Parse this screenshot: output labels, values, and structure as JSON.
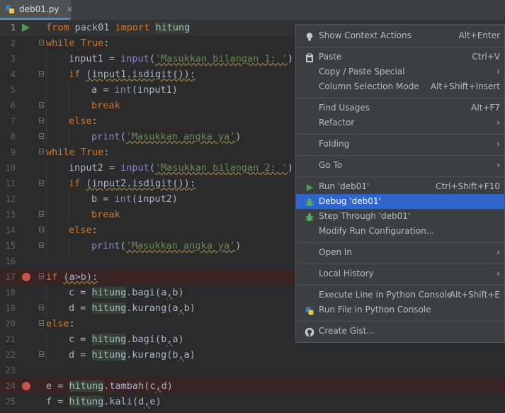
{
  "tab": {
    "filename": "deb01.py",
    "close": "×"
  },
  "editor": {
    "lines": [
      {
        "n": "1"
      },
      {
        "n": "2"
      },
      {
        "n": "3"
      },
      {
        "n": "4"
      },
      {
        "n": "5"
      },
      {
        "n": "6"
      },
      {
        "n": "7"
      },
      {
        "n": "8"
      },
      {
        "n": "9"
      },
      {
        "n": "10"
      },
      {
        "n": "11"
      },
      {
        "n": "12"
      },
      {
        "n": "13"
      },
      {
        "n": "14"
      },
      {
        "n": "15"
      },
      {
        "n": "16"
      },
      {
        "n": "17"
      },
      {
        "n": "18"
      },
      {
        "n": "19"
      },
      {
        "n": "20"
      },
      {
        "n": "21"
      },
      {
        "n": "22"
      },
      {
        "n": "23"
      },
      {
        "n": "24"
      },
      {
        "n": "25"
      }
    ],
    "tok": {
      "from": "from",
      "pack01": " pack01 ",
      "import": "import",
      "hitung": "hitung",
      "while": "while",
      "true": "True",
      "colon": ":",
      "input1": "input1 = ",
      "input": "input",
      "lp": "(",
      "rp": ")",
      "prompt1": "'Masukkan bilangan 1: '",
      "prompt2": "'Masukkan bilangan 2: '",
      "if": "if",
      "sp": " ",
      "cond1": "(input1.isdigit()):",
      "cond2": "(input2.isdigit()):",
      "a_eq": "a = ",
      "b_eq": "b = ",
      "int": "int",
      "arg1": "(input1)",
      "arg2": "(input2)",
      "break": "break",
      "else": "else",
      "print": "print",
      "msg": "'Masukkan angka ya'",
      "input2": "input2 = ",
      "cond_ab": "(a>b):",
      "c_eq": "c = ",
      "d_eq": "d = ",
      "bagi": ".bagi(",
      "kurang": ".kurang(",
      "tambah": ".tambah(",
      "kali": ".kali(",
      "a": "a",
      "b": "b",
      "c": "c",
      "d": "d",
      "comma": ",",
      "e_eq": "e = ",
      "f_eq": "f = "
    }
  },
  "menu": {
    "items": [
      {
        "label": "Show Context Actions",
        "shortcut": "Alt+Enter",
        "icon": "lightbulb-icon"
      },
      {
        "label": "Paste",
        "shortcut": "Ctrl+V",
        "icon": "clipboard-icon"
      },
      {
        "label": "Copy / Paste Special",
        "submenu": "›"
      },
      {
        "label": "Column Selection Mode",
        "shortcut": "Alt+Shift+Insert"
      },
      {
        "label": "Find Usages",
        "shortcut": "Alt+F7"
      },
      {
        "label": "Refactor",
        "submenu": "›"
      },
      {
        "label": "Folding",
        "submenu": "›"
      },
      {
        "label": "Go To",
        "submenu": "›"
      },
      {
        "label": "Run 'deb01'",
        "shortcut": "Ctrl+Shift+F10",
        "icon": "run-icon"
      },
      {
        "label": "Debug 'deb01'",
        "icon": "bug-icon"
      },
      {
        "label": "Step Through 'deb01'",
        "icon": "bug-icon"
      },
      {
        "label": "Modify Run Configuration..."
      },
      {
        "label": "Open In",
        "submenu": "›"
      },
      {
        "label": "Local History",
        "submenu": "›"
      },
      {
        "label": "Execute Line in Python Console",
        "shortcut": "Alt+Shift+E"
      },
      {
        "label": "Run File in Python Console",
        "icon": "python-icon"
      },
      {
        "label": "Create Gist...",
        "icon": "github-icon"
      }
    ]
  },
  "colors": {
    "background": "#2b2b2b",
    "keyword": "#cc7832",
    "string": "#6a8759",
    "builtin": "#8888c6",
    "selection": "#2f65ca",
    "breakpoint": "#c75450",
    "run": "#499c54"
  }
}
